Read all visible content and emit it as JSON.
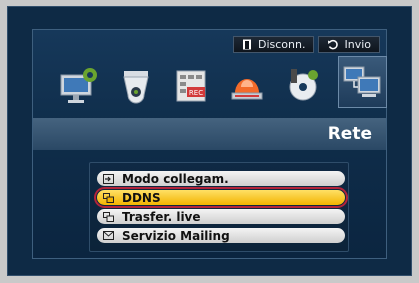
{
  "toolbar": {
    "disconnect_label": "Disconn.",
    "back_label": "Invio"
  },
  "section_title": "Rete",
  "menu": {
    "items": [
      {
        "label": "Modo collegam.",
        "icon": "login-arrow-icon",
        "selected": false
      },
      {
        "label": "DDNS",
        "icon": "network-icon",
        "selected": true
      },
      {
        "label": "Trasfer. live",
        "icon": "network-icon",
        "selected": false
      },
      {
        "label": "Servizio Mailing",
        "icon": "mail-icon",
        "selected": false
      }
    ]
  },
  "icons": [
    "settings-monitor-icon",
    "camera-icon",
    "record-schedule-icon",
    "alarm-siren-icon",
    "backup-disc-icon",
    "network-computers-icon"
  ],
  "colors": {
    "background": "#0e2a45",
    "selected": "#f2b300",
    "selected_border": "#b3243a"
  }
}
